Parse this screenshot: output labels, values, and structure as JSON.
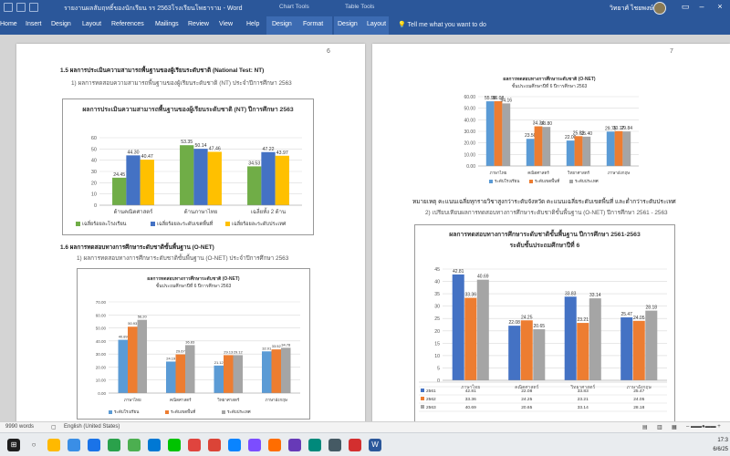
{
  "titlebar": {
    "title": "รายงานผลสัมฤทธิ์ของนักเรียน รร 2563โรงเรียนโพธาราม - Word",
    "chart_tools": "Chart Tools",
    "table_tools": "Table Tools",
    "user": "วิทยาศ์ ไชยพงษ์"
  },
  "ribbon": {
    "tabs": [
      "Home",
      "Insert",
      "Design",
      "Layout",
      "References",
      "Mailings",
      "Review",
      "View",
      "Help",
      "Design",
      "Format",
      "Design",
      "Layout"
    ],
    "tell_me": "Tell me what you want to do"
  },
  "left_page": {
    "page_number": "6",
    "nt_heading": "1.5 ผลการประเมินความสามารถพื้นฐานของผู้เรียนระดับชาติ (National Test: NT)",
    "nt_sub": "1) ผลการทดสอบความสามารถพื้นฐานของผู้เรียนระดับชาติ (NT) ประจำปีการศึกษา 2563",
    "onet_heading": "1.6 ผลการทดสอบทางการศึกษาระดับชาติขั้นพื้นฐาน (O-NET)",
    "onet_sub": "1) ผลการทดสอบทางการศึกษาระดับชาติขั้นพื้นฐาน (O-NET) ประจำปีการศึกษา 2563"
  },
  "right_page": {
    "page_number": "7",
    "note": "หมายเหตุ คะแนนเฉลี่ยทุกรายวิชาสูงกว่าระดับจังหวัด คะแนนเฉลี่ยระดับเขตพื้นที่ และต่ำกว่าระดับประเทศ",
    "compare_sub": "2) เปรียบเทียบผลการทดสอบทางการศึกษาระดับชาติขั้นพื้นฐาน (O-NET) ปีการศึกษา 2561 - 2563"
  },
  "statusbar": {
    "words": "9990 words",
    "language": "English (United States)"
  },
  "taskbar": {
    "time": "17:3",
    "date": "6/6/25"
  },
  "chart_data": [
    {
      "type": "bar",
      "title": "ผลการประเมินความสามารถพื้นฐานของผู้เรียนระดับชาติ (NT) ปีการศึกษา 2563",
      "categories": [
        "ด้านคณิตศาสตร์",
        "ด้านภาษาไทย",
        "เฉลี่ยทั้ง 2 ด้าน"
      ],
      "series": [
        {
          "name": "เฉลี่ยร้อยละโรงเรียน",
          "color": "#70ad47",
          "values": [
            24.45,
            53.35,
            34.53
          ]
        },
        {
          "name": "เฉลี่ยร้อยละระดับเขตพื้นที่",
          "color": "#4472c4",
          "values": [
            44.3,
            50.14,
            47.22
          ]
        },
        {
          "name": "เฉลี่ยร้อยละระดับประเทศ",
          "color": "#ffc000",
          "values": [
            40.47,
            47.46,
            43.97
          ]
        }
      ],
      "ylim": [
        0,
        60
      ],
      "yticks": [
        0,
        10,
        20,
        30,
        40,
        50,
        60
      ],
      "grid": true,
      "legend": "bottom"
    },
    {
      "type": "bar",
      "title": "ผลการทดสอบทางการศึกษาระดับชาติ (O-NET)",
      "subtitle": "ชั้นประถมศึกษาปีที่ 6 ปีการศึกษา 2563",
      "categories": [
        "ภาษาไทย",
        "คณิตศาสตร์",
        "วิทยาศาสตร์",
        "ภาษาอังกฤษ"
      ],
      "series": [
        {
          "name": "ระดับโรงเรียน",
          "color": "#5b9bd5",
          "values": [
            40.89,
            24.19,
            21.12,
            32.01
          ]
        },
        {
          "name": "ระดับเขตพื้นที่",
          "color": "#ed7d31",
          "values": [
            50.93,
            29.67,
            29.13,
            33.52
          ]
        },
        {
          "name": "ระดับประเทศ",
          "color": "#a5a5a5",
          "values": [
            56.2,
            36.83,
            29.12,
            34.78
          ]
        }
      ],
      "ylim": [
        0,
        70
      ],
      "yticks": [
        0,
        10,
        20,
        30,
        40,
        50,
        60,
        70
      ],
      "grid": true,
      "legend": "bottom"
    },
    {
      "type": "bar",
      "title": "ผลการทดสอบทางการศึกษาระดับชาติ (O-NET)",
      "subtitle": "ชั้นประถมศึกษาปีที่ 6 ปีการศึกษา 2563",
      "categories": [
        "ภาษาไทย",
        "คณิตศาสตร์",
        "วิทยาศาสตร์",
        "ภาษาอังกฤษ"
      ],
      "series": [
        {
          "name": "ระดับโรงเรียน",
          "color": "#5b9bd5",
          "values": [
            55.98,
            23.5,
            22.0,
            29.75
          ]
        },
        {
          "name": "ระดับเขตพื้นที่",
          "color": "#ed7d31",
          "values": [
            56.08,
            34.34,
            25.83,
            30.17
          ]
        },
        {
          "name": "ระดับประเทศ",
          "color": "#a5a5a5",
          "values": [
            54.16,
            33.8,
            25.4,
            29.84
          ]
        }
      ],
      "ylim": [
        0,
        60
      ],
      "yticks": [
        0,
        10,
        20,
        30,
        40,
        50,
        60
      ],
      "grid": true,
      "legend": "bottom"
    },
    {
      "type": "bar",
      "title": "ผลการทดสอบทางการศึกษาระดับชาติขั้นพื้นฐาน ปีการศึกษา 2561-2563",
      "subtitle": "ระดับชั้นประถมศึกษาปีที่ 6",
      "categories": [
        "ภาษาไทย",
        "คณิตศาสตร์",
        "วิทยาศาสตร์",
        "ภาษาอังกฤษ"
      ],
      "series": [
        {
          "name": "2561",
          "color": "#4472c4",
          "values": [
            42.81,
            22.08,
            33.83,
            25.47
          ]
        },
        {
          "name": "2562",
          "color": "#ed7d31",
          "values": [
            33.36,
            24.25,
            23.21,
            24.05
          ]
        },
        {
          "name": "2563",
          "color": "#a5a5a5",
          "values": [
            40.69,
            20.65,
            33.14,
            28.18
          ]
        }
      ],
      "ylim": [
        0,
        45
      ],
      "yticks": [
        0,
        5,
        10,
        15,
        20,
        25,
        30,
        35,
        40,
        45
      ],
      "grid": true,
      "legend": "table"
    }
  ]
}
